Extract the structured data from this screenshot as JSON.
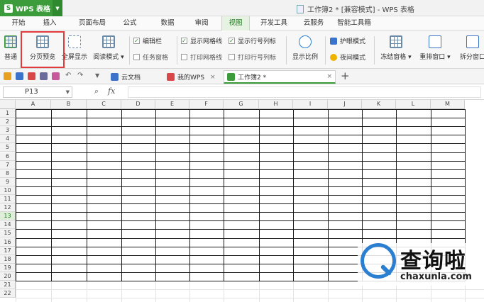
{
  "app": {
    "button_label": "WPS 表格",
    "logo_letter": "S"
  },
  "window": {
    "title": "工作簿2 * [兼容模式] - WPS 表格"
  },
  "menu": {
    "tabs": [
      "开始",
      "插入",
      "页面布局",
      "公式",
      "数据",
      "审阅",
      "视图",
      "开发工具",
      "云服务",
      "智能工具箱"
    ],
    "active": "视图"
  },
  "ribbon": {
    "normal": "普通",
    "page_break_preview": "分页预览",
    "full_screen": "全屏显示",
    "reading_mode": "阅读模式",
    "edit_bar": "编辑栏",
    "task_pane": "任务窗格",
    "show_gridlines": "显示网格线",
    "print_gridlines": "打印网格线",
    "show_row_col_headers": "显示行号列标",
    "print_row_col_headers": "打印行号列标",
    "zoom": "显示比例",
    "eye_protection": "护眼模式",
    "night_mode": "夜间模式",
    "freeze_panes": "冻结窗格",
    "arrange_windows": "重排窗口",
    "split_window": "拆分窗口"
  },
  "doc_tabs": {
    "cloud_docs": "云文档",
    "my_wps": "我的WPS",
    "workbook": "工作簿2 *",
    "close": "×",
    "add": "+"
  },
  "formula_bar": {
    "cell_ref": "P13",
    "fx": "fx",
    "zoom_icon": "magnifier-icon"
  },
  "sheet": {
    "columns": [
      "A",
      "B",
      "C",
      "D",
      "E",
      "F",
      "G",
      "H",
      "I",
      "J",
      "K",
      "L",
      "M"
    ],
    "rows": [
      "1",
      "2",
      "3",
      "4",
      "5",
      "6",
      "7",
      "8",
      "9",
      "10",
      "11",
      "12",
      "13",
      "14",
      "15",
      "16",
      "17",
      "18",
      "19",
      "20",
      "21",
      "22"
    ],
    "selected_row": "13"
  },
  "watermark": {
    "brand": "查询啦",
    "site": "chaxunla.com"
  },
  "colors": {
    "accent": "#3c9c3c",
    "highlight": "#e23b3b",
    "brand_blue": "#2b7fd0"
  }
}
